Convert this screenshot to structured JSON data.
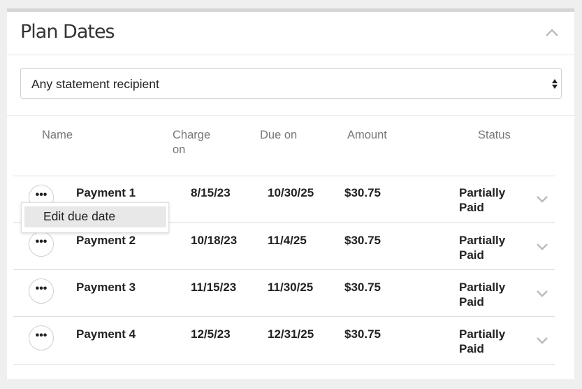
{
  "panel": {
    "title": "Plan Dates"
  },
  "filter": {
    "selected": "Any statement recipient"
  },
  "table": {
    "headers": {
      "name": "Name",
      "charge_on": "Charge on",
      "due_on": "Due on",
      "amount": "Amount",
      "status": "Status"
    },
    "rows": [
      {
        "name": "Payment 1",
        "charge_on": "8/15/23",
        "due_on": "10/30/25",
        "amount": "$30.75",
        "status": "Partially Paid"
      },
      {
        "name": "Payment 2",
        "charge_on": "10/18/23",
        "due_on": "11/4/25",
        "amount": "$30.75",
        "status": "Partially Paid"
      },
      {
        "name": "Payment 3",
        "charge_on": "11/15/23",
        "due_on": "11/30/25",
        "amount": "$30.75",
        "status": "Partially Paid"
      },
      {
        "name": "Payment 4",
        "charge_on": "12/5/23",
        "due_on": "12/31/25",
        "amount": "$30.75",
        "status": "Partially Paid"
      }
    ]
  },
  "row_menu": {
    "items": [
      "Edit due date"
    ]
  },
  "icons": {
    "collapse": "chevron-up-icon",
    "expand": "chevron-down-icon",
    "more": "ellipsis-icon",
    "select": "sort-arrows-icon"
  },
  "colors": {
    "muted_text": "#777777",
    "chevron": "#bbbbbb",
    "menu_highlight": "#e8e8e8"
  }
}
